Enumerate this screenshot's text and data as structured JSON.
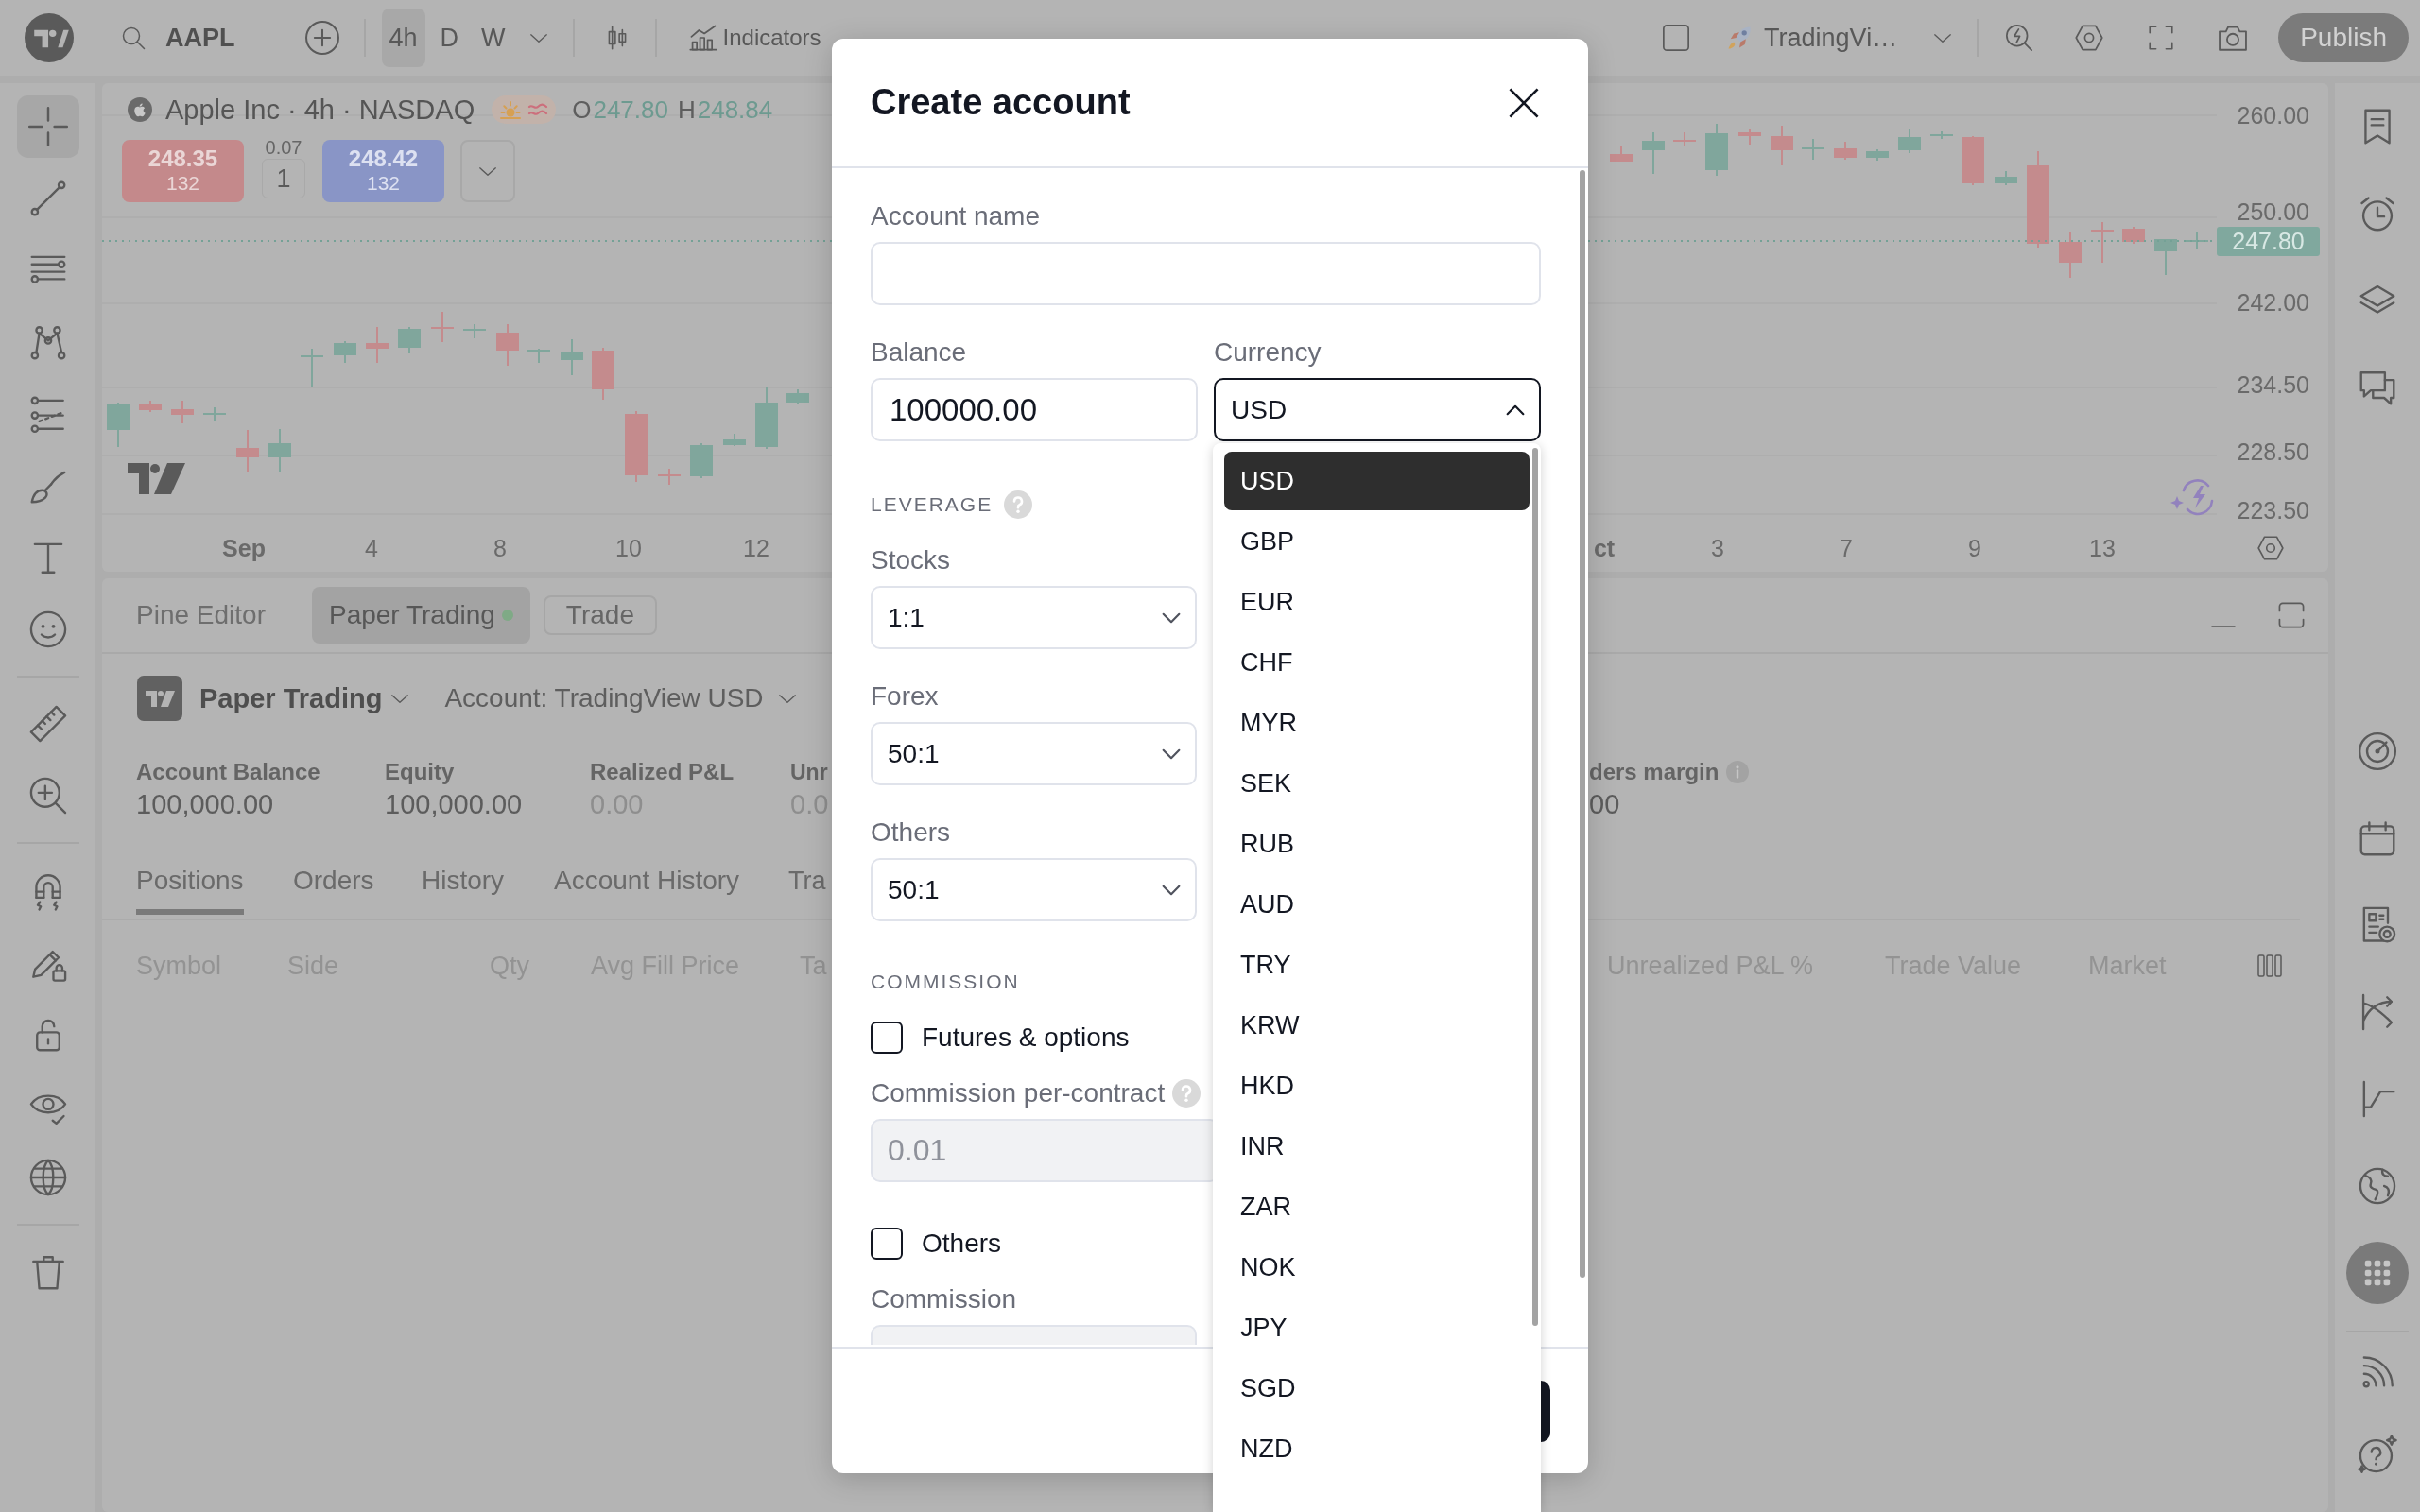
{
  "toolbar": {
    "symbol": "AAPL",
    "intervals": [
      {
        "label": "4h",
        "selected": true
      },
      {
        "label": "D",
        "selected": false
      },
      {
        "label": "W",
        "selected": false
      }
    ],
    "indicators": "Indicators",
    "layout": "TradingVi…",
    "publish": "Publish"
  },
  "left_toolbar": [
    {
      "tools": [
        {
          "kind": "crosshair",
          "selected": true
        },
        {
          "kind": "trend-line",
          "selected": false
        },
        {
          "kind": "horizontal-lines",
          "selected": false
        },
        {
          "kind": "pattern",
          "selected": false
        },
        {
          "kind": "projection",
          "selected": false
        },
        {
          "kind": "brush",
          "selected": false
        },
        {
          "kind": "text",
          "selected": false
        },
        {
          "kind": "emoji",
          "selected": false
        }
      ]
    },
    {
      "tools": [
        {
          "kind": "ruler",
          "selected": false
        },
        {
          "kind": "zoom-in",
          "selected": false
        }
      ]
    },
    {
      "tools": [
        {
          "kind": "magnet",
          "selected": false
        },
        {
          "kind": "pencil-lock",
          "selected": false
        },
        {
          "kind": "lock",
          "selected": false
        },
        {
          "kind": "eye",
          "selected": false
        },
        {
          "kind": "globe",
          "selected": false
        }
      ]
    },
    {
      "tools": [
        {
          "kind": "trash",
          "selected": false
        }
      ]
    }
  ],
  "chart": {
    "title": "Apple Inc · 4h · NASDAQ",
    "ohlc": [
      {
        "label": "O",
        "value": "247.80"
      },
      {
        "label": "H",
        "value": "248.84"
      }
    ],
    "orders": [
      {
        "kind": "sell",
        "price": "248.35",
        "size": "132"
      },
      {
        "kind": "buy",
        "price": "248.42",
        "size": "132"
      }
    ],
    "spread": "0.07",
    "quantity": "1",
    "price_axis": [
      "260.00",
      "250.00",
      "242.00",
      "234.50",
      "228.50",
      "223.50"
    ],
    "last_price": "247.80",
    "time_axis": [
      {
        "label": "Sep",
        "kind": "month"
      },
      {
        "label": "4",
        "kind": "day"
      },
      {
        "label": "8",
        "kind": "day"
      },
      {
        "label": "10",
        "kind": "day"
      },
      {
        "label": "12",
        "kind": "day"
      },
      {
        "label": "ct",
        "kind": "month"
      },
      {
        "label": "3",
        "kind": "day"
      },
      {
        "label": "7",
        "kind": "day"
      },
      {
        "label": "9",
        "kind": "day"
      },
      {
        "label": "13",
        "kind": "day"
      }
    ]
  },
  "bottom_panel": {
    "tabs": [
      {
        "label": "Pine Editor",
        "selected": false,
        "live": false
      },
      {
        "label": "Paper Trading",
        "selected": true,
        "live": true
      }
    ],
    "trade_button": "Trade",
    "broker": "Paper Trading",
    "account": "Account: TradingView USD",
    "stats": [
      {
        "label": "Account Balance",
        "value": "100,000.00",
        "muted": false,
        "info": false
      },
      {
        "label": "Equity",
        "value": "100,000.00",
        "muted": false,
        "info": false
      },
      {
        "label": "Realized P&L",
        "value": "0.00",
        "muted": true,
        "info": false
      },
      {
        "label": "Unr",
        "value": "0.0",
        "muted": true,
        "info": false
      },
      {
        "label": "ders margin",
        "value": "00",
        "muted": false,
        "info": true
      }
    ],
    "views": [
      {
        "label": "Positions",
        "selected": true
      },
      {
        "label": "Orders",
        "selected": false
      },
      {
        "label": "History",
        "selected": false
      },
      {
        "label": "Account History",
        "selected": false
      },
      {
        "label": "Tra",
        "selected": false
      }
    ],
    "columns": [
      "Symbol",
      "Side",
      "Qty",
      "Avg Fill Price",
      "Ta",
      "Unrealized P&L %",
      "Trade Value",
      "Market"
    ]
  },
  "right_toolbar": [
    {
      "tools": [
        {
          "kind": "watchlist",
          "selected": false
        },
        {
          "kind": "alarm",
          "selected": false
        },
        {
          "kind": "layers",
          "selected": false
        },
        {
          "kind": "chat",
          "selected": false
        }
      ]
    },
    {
      "tools": [
        {
          "kind": "target",
          "selected": false
        },
        {
          "kind": "calendar",
          "selected": false
        },
        {
          "kind": "report",
          "selected": false
        },
        {
          "kind": "curves",
          "selected": false
        },
        {
          "kind": "chart-line",
          "selected": false
        },
        {
          "kind": "world",
          "selected": false
        },
        {
          "kind": "apps",
          "selected": true
        }
      ]
    },
    {
      "tools": [
        {
          "kind": "signal",
          "selected": false
        },
        {
          "kind": "help",
          "selected": false
        }
      ]
    }
  ],
  "dialog": {
    "title": "Create account",
    "account_name": {
      "label": "Account name"
    },
    "balance": {
      "label": "Balance",
      "value": "100000.00"
    },
    "currency": {
      "label": "Currency",
      "value": "USD",
      "expanded": true,
      "options": [
        {
          "label": "USD",
          "selected": true
        },
        {
          "label": "GBP",
          "selected": false
        },
        {
          "label": "EUR",
          "selected": false
        },
        {
          "label": "CHF",
          "selected": false
        },
        {
          "label": "MYR",
          "selected": false
        },
        {
          "label": "SEK",
          "selected": false
        },
        {
          "label": "RUB",
          "selected": false
        },
        {
          "label": "AUD",
          "selected": false
        },
        {
          "label": "TRY",
          "selected": false
        },
        {
          "label": "KRW",
          "selected": false
        },
        {
          "label": "HKD",
          "selected": false
        },
        {
          "label": "INR",
          "selected": false
        },
        {
          "label": "ZAR",
          "selected": false
        },
        {
          "label": "NOK",
          "selected": false
        },
        {
          "label": "JPY",
          "selected": false
        },
        {
          "label": "SGD",
          "selected": false
        },
        {
          "label": "NZD",
          "selected": false
        }
      ]
    },
    "leverage": {
      "heading": "LEVERAGE",
      "help": true,
      "selects": [
        {
          "label": "Stocks",
          "value": "1:1"
        },
        {
          "label": "Forex",
          "value": "50:1"
        },
        {
          "label": "Others",
          "value": "50:1"
        }
      ]
    },
    "commission": {
      "heading": "COMMISSION",
      "groups": [
        {
          "option": "Futures & options",
          "checked": false,
          "field_label": "Commission per-contract",
          "help": true,
          "value": "0.01",
          "disabled": true
        },
        {
          "option": "Others",
          "checked": false,
          "field_label": "Commission",
          "help": false,
          "disabled": true
        }
      ]
    }
  }
}
